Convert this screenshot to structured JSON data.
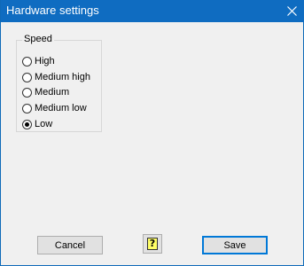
{
  "window": {
    "title": "Hardware settings"
  },
  "speed_group": {
    "label": "Speed",
    "options": [
      {
        "label": "High",
        "selected": false
      },
      {
        "label": "Medium high",
        "selected": false
      },
      {
        "label": "Medium",
        "selected": false
      },
      {
        "label": "Medium low",
        "selected": false
      },
      {
        "label": "Low",
        "selected": true
      }
    ]
  },
  "buttons": {
    "cancel_label": "Cancel",
    "save_label": "Save",
    "help_glyph": "?"
  },
  "colors": {
    "titlebar": "#0f6cc1",
    "dialog_background": "#f0f0f0",
    "default_button_border": "#0078d7",
    "help_icon": "#ffff66"
  },
  "icons": {
    "close": "close-icon",
    "help": "help-icon"
  }
}
